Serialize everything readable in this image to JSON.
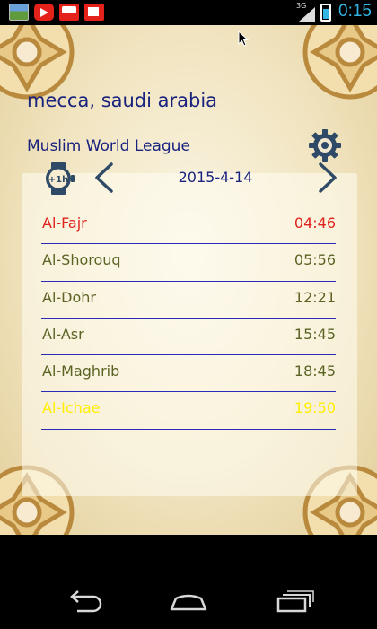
{
  "statusbar": {
    "network_type": "3G",
    "time": "0:15",
    "notification_icons": [
      "gallery-icon",
      "youtube-icon",
      "youtube-icon",
      "youtube-icon"
    ]
  },
  "header": {
    "location": "mecca, saudi arabia",
    "calculation_method": "Muslim World League"
  },
  "date_nav": {
    "date": "2015-4-14",
    "hour_adjust_icon": "plus-1h-watch-icon",
    "hour_adjust_label": "+1h"
  },
  "prayers": [
    {
      "name": "Al-Fajr",
      "time": "04:46"
    },
    {
      "name": "Al-Shorouq",
      "time": "05:56"
    },
    {
      "name": "Al-Dohr",
      "time": "12:21"
    },
    {
      "name": "Al-Asr",
      "time": "15:45"
    },
    {
      "name": "Al-Maghrib",
      "time": "18:45"
    },
    {
      "name": "Al-Ichae",
      "time": "19:50"
    }
  ],
  "colors": {
    "accent_blue": "#1a237e",
    "current_prayer": "#e0221c",
    "next_prayer": "#ffee00",
    "prayer_text": "#5b6424",
    "divider": "#2a2ab8",
    "status_clock": "#33b5e5"
  }
}
